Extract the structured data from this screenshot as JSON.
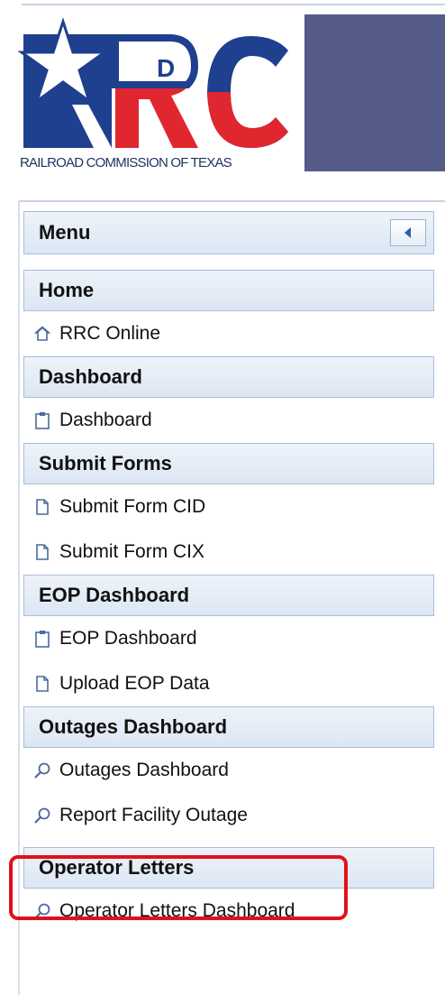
{
  "header": {
    "logo_letters": "RRC",
    "logo_small_letter": "D",
    "logo_caption": "RAILROAD COMMISSION OF TEXAS",
    "banner_color": "#545c87"
  },
  "menu": {
    "title": "Menu",
    "sections": [
      {
        "label": "Home",
        "items": [
          {
            "label": "RRC Online",
            "icon": "home-icon"
          }
        ]
      },
      {
        "label": "Dashboard",
        "items": [
          {
            "label": "Dashboard",
            "icon": "clipboard-icon"
          }
        ]
      },
      {
        "label": "Submit Forms",
        "items": [
          {
            "label": "Submit Form CID",
            "icon": "document-icon"
          },
          {
            "label": "Submit Form CIX",
            "icon": "document-icon"
          }
        ]
      },
      {
        "label": "EOP Dashboard",
        "items": [
          {
            "label": "EOP Dashboard",
            "icon": "clipboard-icon"
          },
          {
            "label": "Upload EOP Data",
            "icon": "document-icon"
          }
        ]
      },
      {
        "label": "Outages Dashboard",
        "items": [
          {
            "label": "Outages Dashboard",
            "icon": "search-icon"
          },
          {
            "label": "Report Facility Outage",
            "icon": "search-icon"
          }
        ]
      },
      {
        "label": "Operator Letters",
        "items": [
          {
            "label": "Operator Letters Dashboard",
            "icon": "search-icon"
          }
        ]
      }
    ]
  },
  "colors": {
    "highlight": "#e0111a",
    "header_bg": "#dce6f3",
    "logo_blue": "#1f3f8f",
    "logo_red": "#e0262f"
  }
}
